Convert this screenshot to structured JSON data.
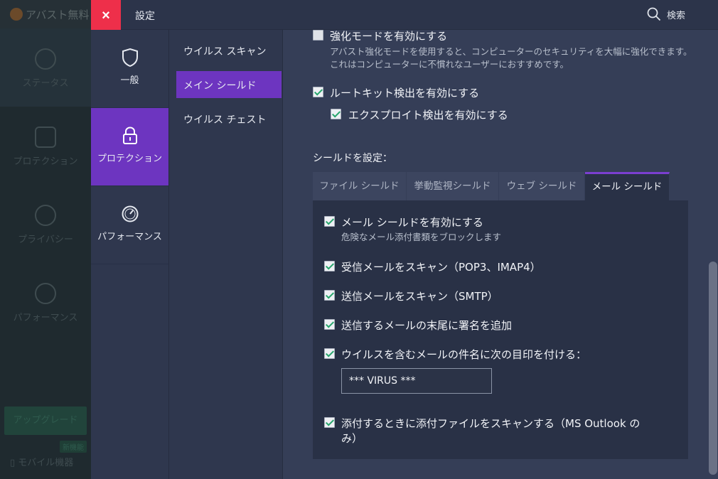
{
  "background_app": {
    "title": "アバスト無料",
    "nav": [
      "ステータス",
      "プロテクション",
      "プライバシー",
      "パフォーマンス"
    ],
    "upgrade_label": "アップグレード",
    "new_badge": "新機能",
    "mobile_label": "モバイル機器"
  },
  "topbar": {
    "close_label": "×",
    "title": "設定",
    "search_label": "検索"
  },
  "categories": [
    {
      "label": "一般",
      "icon": "shield-icon"
    },
    {
      "label": "プロテクション",
      "icon": "lock-icon",
      "active": true
    },
    {
      "label": "パフォーマンス",
      "icon": "gauge-icon"
    }
  ],
  "submenu": [
    {
      "label": "ウイルス スキャン"
    },
    {
      "label": "メイン シールド",
      "active": true
    },
    {
      "label": "ウイルス チェスト"
    }
  ],
  "content": {
    "hardened_mode": {
      "label": "強化モードを有効にする",
      "checked": false,
      "desc": "アバスト強化モードを使用すると、コンピューターのセキュリティを大幅に強化できます。これはコンピューターに不慣れなユーザーにおすすめです。"
    },
    "rootkit": {
      "label": "ルートキット検出を有効にする",
      "checked": true
    },
    "exploit": {
      "label": "エクスプロイト検出を有効にする",
      "checked": true
    },
    "shield_heading": "シールドを設定：",
    "tabs": [
      "ファイル シールド",
      "挙動監視シールド",
      "ウェブ シールド",
      "メール シールド"
    ],
    "active_tab": "メール シールド",
    "mail_shield": {
      "enable": {
        "label": "メール シールドを有効にする",
        "desc": "危険なメール添付書類をブロックします",
        "checked": true
      },
      "incoming": {
        "label": "受信メールをスキャン（POP3、IMAP4）",
        "checked": true
      },
      "outgoing": {
        "label": "送信メールをスキャン（SMTP）",
        "checked": true
      },
      "signature": {
        "label": "送信するメールの末尾に署名を追加",
        "checked": true
      },
      "mark_subject": {
        "label": "ウイルスを含むメールの件名に次の目印を付ける：",
        "checked": true,
        "value": "*** VIRUS ***"
      },
      "attach_scan": {
        "label_line1": "添付するときに添付ファイルをスキャンする（MS Outlook の",
        "label_line2": "み）",
        "checked": true
      }
    }
  },
  "colors": {
    "accent": "#6d35c0",
    "close": "#ee2f4a",
    "check": "#26a56c"
  }
}
